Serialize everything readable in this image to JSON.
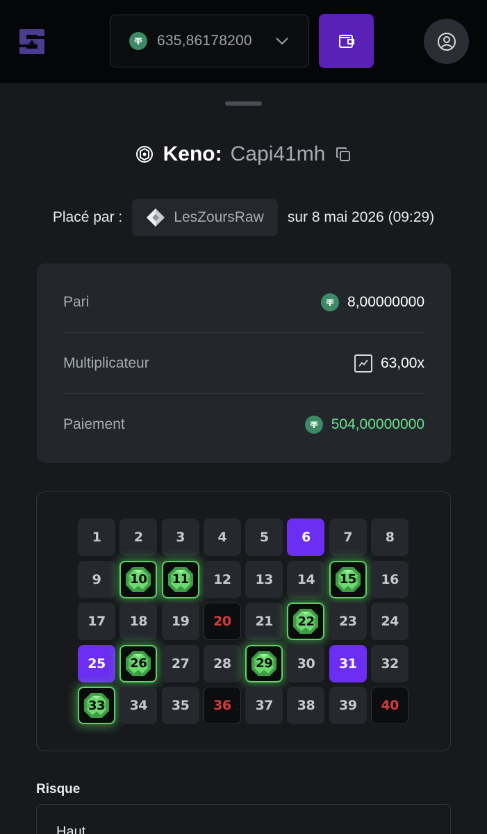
{
  "header": {
    "balance": "635,86178200",
    "currency_icon": "tether-icon",
    "brand_color": "#5b21b6"
  },
  "bet": {
    "game": "Keno:",
    "bet_id": "Capi41mh",
    "placed_by_label": "Placé par :",
    "username": "LesZoursRaw",
    "date_text": "sur 8 mai 2026 (09:29)"
  },
  "details": {
    "bet_label": "Pari",
    "bet_value": "8,00000000",
    "multiplier_label": "Multiplicateur",
    "multiplier_value": "63,00x",
    "payout_label": "Paiement",
    "payout_value": "504,00000000",
    "payout_color": "#6ddf8f"
  },
  "keno": {
    "numbers": [
      "1",
      "2",
      "3",
      "4",
      "5",
      "6",
      "7",
      "8",
      "9",
      "10",
      "11",
      "12",
      "13",
      "14",
      "15",
      "16",
      "17",
      "18",
      "19",
      "20",
      "21",
      "22",
      "23",
      "24",
      "25",
      "26",
      "27",
      "28",
      "29",
      "30",
      "31",
      "32",
      "33",
      "34",
      "35",
      "36",
      "37",
      "38",
      "39",
      "40"
    ],
    "selected_only": [
      6,
      25,
      31
    ],
    "hits": [
      10,
      11,
      15,
      22,
      26,
      29,
      33
    ],
    "misses": [
      20,
      36,
      40
    ],
    "selected_color": "#6b2ef2",
    "hit_color": "#5ad463",
    "miss_color": "#d23b3b"
  },
  "risk": {
    "label": "Risque",
    "value": "Haut"
  }
}
